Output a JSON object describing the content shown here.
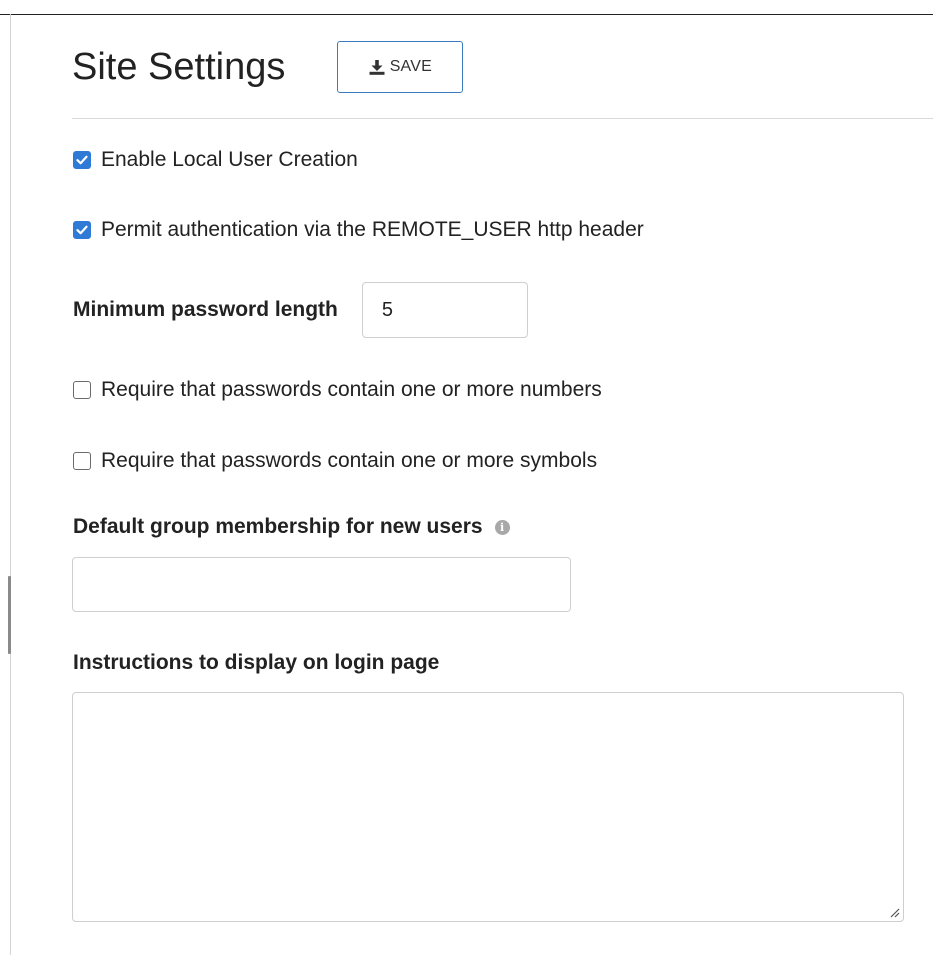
{
  "header": {
    "title": "Site Settings",
    "save_label": "SAVE",
    "save_icon": "download-icon"
  },
  "settings": {
    "enable_local_user_creation": {
      "label": "Enable Local User Creation",
      "checked": true
    },
    "permit_remote_user": {
      "label": "Permit authentication via the REMOTE_USER http header",
      "checked": true
    },
    "min_password_length": {
      "label": "Minimum password length",
      "value": "5"
    },
    "require_numbers": {
      "label": "Require that passwords contain one or more numbers",
      "checked": false
    },
    "require_symbols": {
      "label": "Require that passwords contain one or more symbols",
      "checked": false
    },
    "default_group": {
      "label": "Default group membership for new users",
      "icon": "info-icon",
      "value": ""
    },
    "login_instructions": {
      "label": "Instructions to display on login page",
      "value": ""
    }
  },
  "colors": {
    "accent": "#2f7ad6",
    "save_border": "#3b7cc0"
  }
}
